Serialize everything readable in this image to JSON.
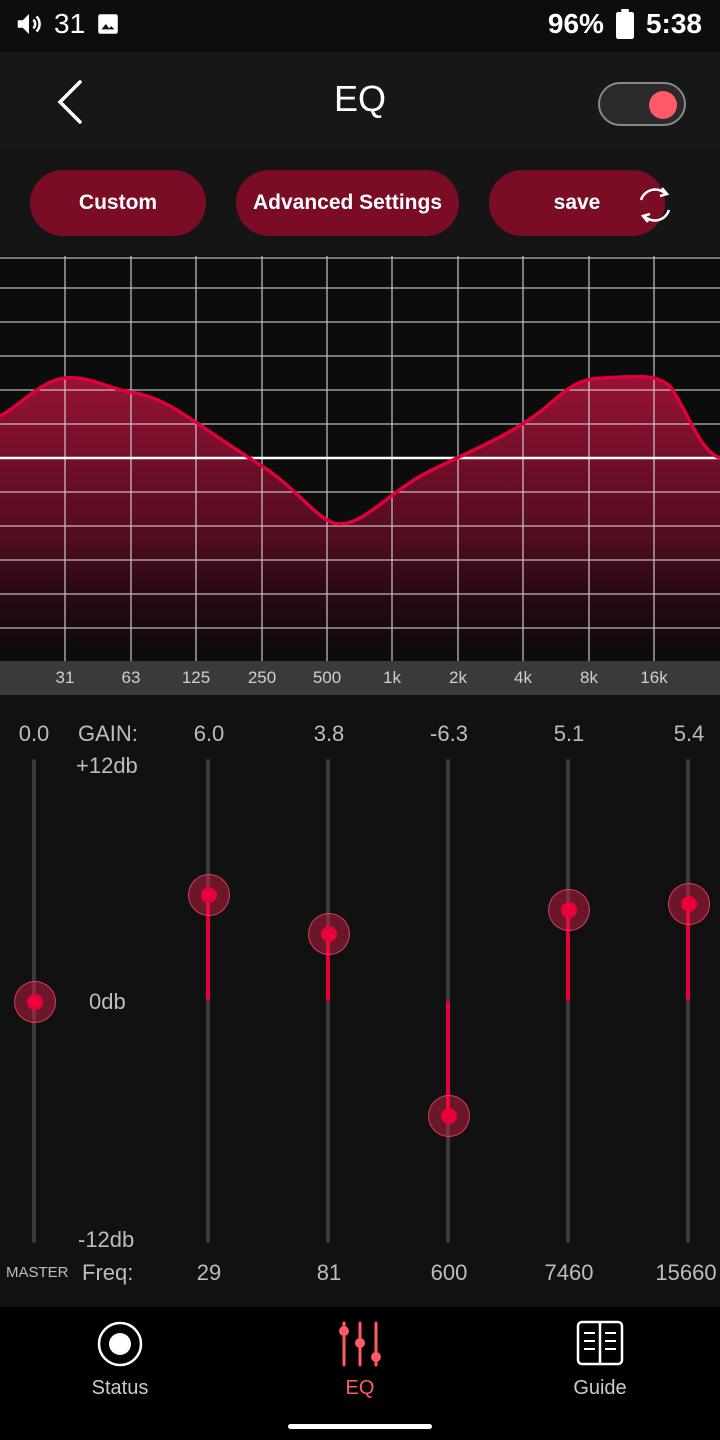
{
  "status_bar": {
    "notification_count": "31",
    "battery": "96%",
    "time": "5:38"
  },
  "header": {
    "title": "EQ",
    "power_toggle_on": true
  },
  "buttons": {
    "custom": "Custom",
    "advanced": "Advanced Settings",
    "save": "save"
  },
  "graph": {
    "freq_labels": [
      "31",
      "63",
      "125",
      "250",
      "500",
      "1k",
      "2k",
      "4k",
      "8k",
      "16k"
    ],
    "curve_color": "#e0003a"
  },
  "eq": {
    "master_value": "0.0",
    "gain_label": "GAIN:",
    "gain_max": "+12db",
    "gain_zero": "0db",
    "gain_min": "-12db",
    "master_label": "MASTER",
    "freq_label": "Freq:",
    "bands": [
      {
        "gain": "6.0",
        "freq": "29"
      },
      {
        "gain": "3.8",
        "freq": "81"
      },
      {
        "gain": "-6.3",
        "freq": "600"
      },
      {
        "gain": "5.1",
        "freq": "7460"
      },
      {
        "gain": "5.4",
        "freq": "15660"
      }
    ]
  },
  "nav": {
    "status": "Status",
    "eq": "EQ",
    "guide": "Guide",
    "active_color": "#ff5a66"
  }
}
